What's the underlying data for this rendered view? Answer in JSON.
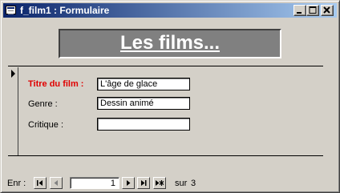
{
  "window": {
    "title": "f_film1 : Formulaire"
  },
  "header": {
    "title": "Les films..."
  },
  "form": {
    "fields": [
      {
        "label": "Titre du film :",
        "value": "L'âge de glace"
      },
      {
        "label": "Genre :",
        "value": "Dessin animé"
      },
      {
        "label": "Critique :",
        "value": ""
      }
    ]
  },
  "navigation": {
    "label": "Enr :",
    "current_record": "1",
    "of_label": "sur",
    "total_records": "3"
  },
  "colors": {
    "titlebar_start": "#0a246a",
    "titlebar_end": "#a6caf0",
    "header_bg": "#808080",
    "required_label": "#e00000",
    "window_bg": "#d4d0c8"
  }
}
